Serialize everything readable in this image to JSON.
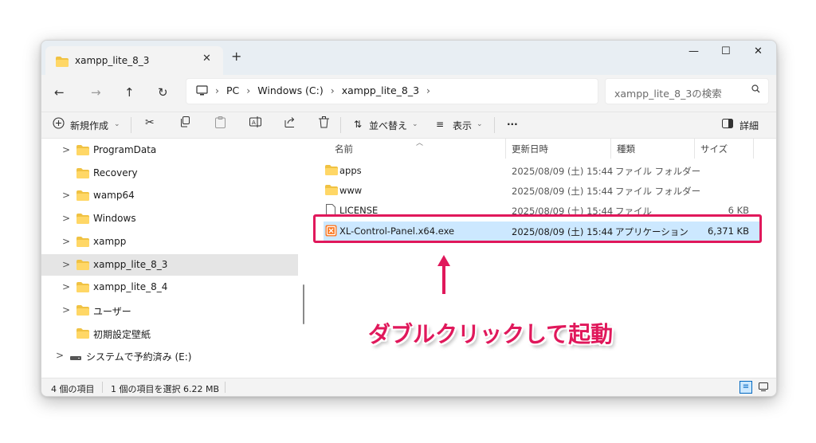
{
  "tab": {
    "title": "xampp_lite_8_3",
    "close": "✕",
    "new": "+"
  },
  "window_controls": {
    "minimize": "—",
    "maximize": "☐",
    "close": "✕"
  },
  "nav": {
    "back": "←",
    "forward": "→",
    "up": "↑",
    "refresh": "↻"
  },
  "address": {
    "crumbs": [
      "PC",
      "Windows (C:)",
      "xampp_lite_8_3"
    ],
    "separator": "›"
  },
  "search": {
    "placeholder": "xampp_lite_8_3の検索",
    "icon": "search-icon"
  },
  "toolbar": {
    "new_label": "新規作成",
    "sort_label": "並べ替え",
    "view_label": "表示",
    "more_label": "···",
    "details_label": "詳細"
  },
  "tree": [
    {
      "label": "ProgramData",
      "chevron": ">"
    },
    {
      "label": "Recovery",
      "chevron": ""
    },
    {
      "label": "wamp64",
      "chevron": ">"
    },
    {
      "label": "Windows",
      "chevron": ">"
    },
    {
      "label": "xampp",
      "chevron": ">"
    },
    {
      "label": "xampp_lite_8_3",
      "chevron": ">"
    },
    {
      "label": "xampp_lite_8_4",
      "chevron": ">"
    },
    {
      "label": "ユーザー",
      "chevron": ">"
    },
    {
      "label": "初期設定壁紙",
      "chevron": ""
    },
    {
      "label": "システムで予約済み (E:)",
      "chevron": ">"
    }
  ],
  "columns": {
    "name": "名前",
    "date": "更新日時",
    "type": "種類",
    "size": "サイズ"
  },
  "files": [
    {
      "name": "apps",
      "date": "2025/08/09 (土) 15:44",
      "type": "ファイル フォルダー",
      "size": ""
    },
    {
      "name": "www",
      "date": "2025/08/09 (土) 15:44",
      "type": "ファイル フォルダー",
      "size": ""
    },
    {
      "name": "LICENSE",
      "date": "2025/08/09 (土) 15:44",
      "type": "ファイル",
      "size": "6 KB"
    },
    {
      "name": "XL-Control-Panel.x64.exe",
      "date": "2025/08/09 (土) 15:44",
      "type": "アプリケーション",
      "size": "6,371 KB"
    }
  ],
  "status": {
    "count": "4 個の項目",
    "selected": "1 個の項目を選択  6.22 MB"
  },
  "annotation": {
    "text": "ダブルクリックして起動"
  },
  "colors": {
    "accent": "#e0185b",
    "selection": "#cce8ff",
    "folder": "#f0c243"
  }
}
